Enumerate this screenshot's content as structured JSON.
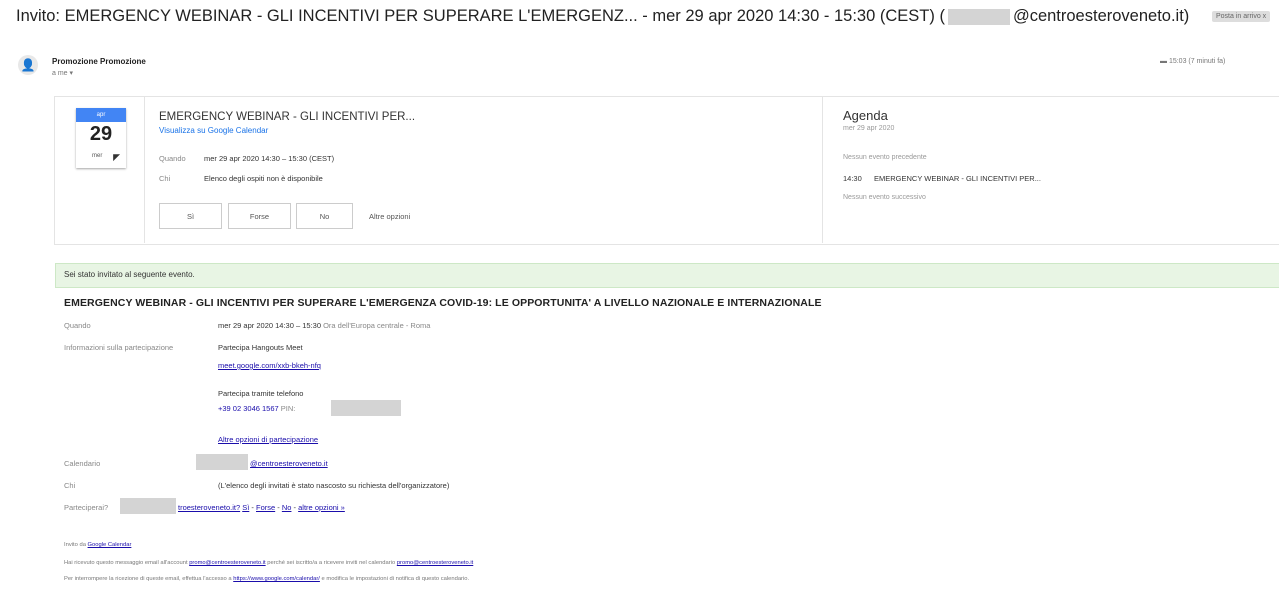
{
  "subject": {
    "prefix": "Invito: EMERGENCY WEBINAR - GLI INCENTIVI PER SUPERARE L'EMERGENZ... - mer 29 apr 2020 14:30 - 15:30 (CEST) (",
    "suffix": "@centroesteroveneto.it)",
    "badge": "Posta in arrivo x"
  },
  "header": {
    "sender": "Promozione Promozione",
    "to": "a me",
    "time": "15:03 (7 minuti fa)"
  },
  "card": {
    "cal_month": "apr",
    "cal_day": "29",
    "cal_dow": "mer",
    "title": "EMERGENCY WEBINAR - GLI INCENTIVI PER...",
    "view_link": "Visualizza su Google Calendar",
    "when_label": "Quando",
    "when_value": "mer 29 apr 2020 14:30 – 15:30 (CEST)",
    "who_label": "Chi",
    "who_value": "Elenco degli ospiti non è disponibile",
    "rsvp": {
      "yes": "Sì",
      "maybe": "Forse",
      "no": "No",
      "more": "Altre opzioni"
    }
  },
  "agenda": {
    "title": "Agenda",
    "date": "mer 29 apr 2020",
    "none_before": "Nessun evento precedente",
    "ev_time": "14:30",
    "ev_title": "EMERGENCY WEBINAR - GLI INCENTIVI PER...",
    "none_after": "Nessun evento successivo"
  },
  "invite": {
    "banner": "Sei stato invitato al seguente evento.",
    "title": "EMERGENCY WEBINAR - GLI INCENTIVI PER SUPERARE L'EMERGENZA COVID-19: LE OPPORTUNITA' A LIVELLO NAZIONALE E INTERNAZIONALE",
    "when_label": "Quando",
    "when_value": "mer 29 apr 2020 14:30 – 15:30",
    "when_tz": "Ora dell'Europa centrale - Roma",
    "info_label": "Informazioni sulla partecipazione",
    "hangouts": "Partecipa Hangouts Meet",
    "meet_link": "meet.google.com/xxb-bkeh-nfq",
    "phone_label": "Partecipa tramite telefono",
    "phone": "+39 02 3046 1567",
    "pin": "PIN:",
    "more_join": "Altre opzioni di partecipazione",
    "cal_label": "Calendario",
    "cal_value": "@centroesteroveneto.it",
    "who_label": "Chi",
    "who_value": "(L'elenco degli invitati è stato nascosto su richiesta dell'organizzatore)",
    "part_label": "Parteciperai?",
    "part_email": "troesteroveneto.it?",
    "part_yes": "Sì",
    "part_maybe": "Forse",
    "part_no": "No",
    "part_more": "altre opzioni »",
    "sep": "-"
  },
  "footer": {
    "line1_pre": "Invito da",
    "line1_link": "Google Calendar",
    "line2": "Hai ricevuto questo messaggio email all'account",
    "line2_link": "promo@centroesteroveneto.it",
    "line2_mid": "perché sei iscritto/a a ricevere inviti nel calendario",
    "line2_link2": "promo@centroesteroveneto.it",
    "line3": "Per interrompere la ricezione di queste email, effettua l'accesso a",
    "line3_link": "https://www.google.com/calendar/",
    "line3_end": "e modifica le impostazioni di notifica di questo calendario."
  }
}
